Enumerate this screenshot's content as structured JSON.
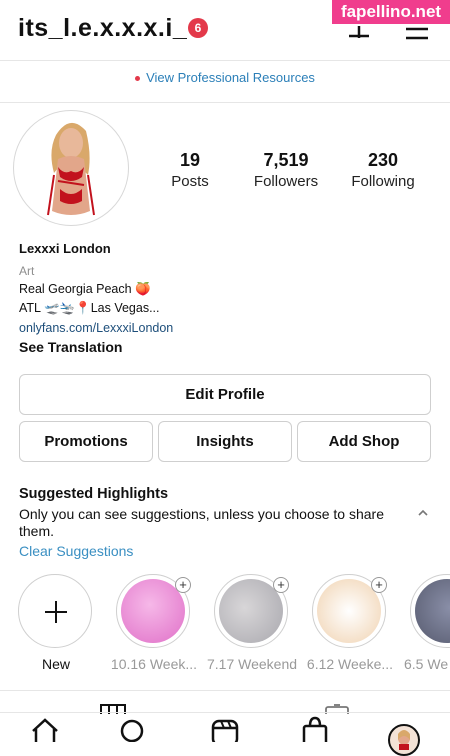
{
  "header": {
    "username": "its_l.e.x.x.x.i_",
    "notification_count": "6"
  },
  "watermark": "fapellino.net",
  "professional_link": "View Professional Resources",
  "profile": {
    "posts": {
      "count": "19",
      "label": "Posts"
    },
    "followers": {
      "count": "7,519",
      "label": "Followers"
    },
    "following": {
      "count": "230",
      "label": "Following"
    }
  },
  "bio": {
    "name": "Lexxxi London",
    "category": "Art",
    "line1": "Real Georgia Peach 🍑",
    "line2": "ATL 🛫🛬📍Las Vegas...",
    "link": "onlyfans.com/LexxxiLondon",
    "see_translation": "See Translation"
  },
  "buttons": {
    "edit_profile": "Edit Profile",
    "promotions": "Promotions",
    "insights": "Insights",
    "add_shop": "Add Shop"
  },
  "suggested": {
    "title": "Suggested Highlights",
    "description": "Only you can see suggestions, unless you choose to share them.",
    "clear": "Clear Suggestions"
  },
  "highlights": [
    {
      "label": "New"
    },
    {
      "label": "10.16 Week..."
    },
    {
      "label": "7.17 Weekend"
    },
    {
      "label": "6.12 Weeke..."
    },
    {
      "label": "6.5 We"
    }
  ],
  "colors": {
    "link_blue": "#2b7fb8",
    "badge_red": "#e3394a",
    "watermark_pink": "#f03d8d"
  }
}
